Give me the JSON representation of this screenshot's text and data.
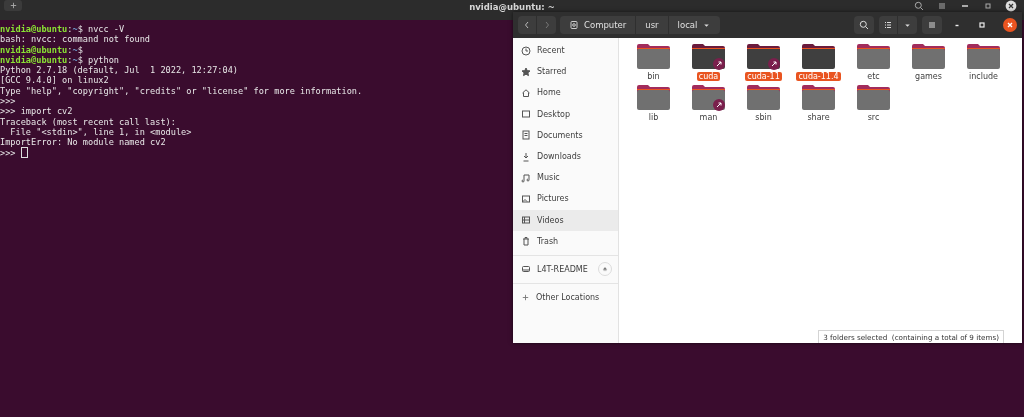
{
  "terminal": {
    "title": "nvidia@ubuntu: ~",
    "lines": [
      {
        "kind": "prompt",
        "user": "nvidia@ubuntu",
        "separator": ":",
        "path": "~",
        "symbol": "$",
        "command": "nvcc -V"
      },
      {
        "kind": "output",
        "text": "bash: nvcc: command not found"
      },
      {
        "kind": "prompt",
        "user": "nvidia@ubuntu",
        "separator": ":",
        "path": "~",
        "symbol": "$"
      },
      {
        "kind": "prompt",
        "user": "nvidia@ubuntu",
        "separator": ":",
        "path": "~",
        "symbol": "$",
        "command": "python"
      },
      {
        "kind": "output",
        "text": "Python 2.7.18 (default, Jul  1 2022, 12:27:04)"
      },
      {
        "kind": "output",
        "text": "[GCC 9.4.0] on linux2"
      },
      {
        "kind": "output",
        "text": "Type \"help\", \"copyright\", \"credits\" or \"license\" for more information."
      },
      {
        "kind": "output",
        "text": ">>>"
      },
      {
        "kind": "output",
        "text": ">>> import cv2"
      },
      {
        "kind": "output",
        "text": "Traceback (most recent call last):"
      },
      {
        "kind": "output",
        "text": "  File \"<stdin>\", line 1, in <module>"
      },
      {
        "kind": "output",
        "text": "ImportError: No module named cv2"
      },
      {
        "kind": "input",
        "text": ">>>"
      }
    ]
  },
  "files": {
    "path": [
      {
        "label": "Computer",
        "kind": "root"
      },
      {
        "label": "usr",
        "kind": "folder"
      },
      {
        "label": "local",
        "kind": "current"
      }
    ],
    "sidebar": [
      {
        "label": "Recent",
        "selected": false
      },
      {
        "label": "Starred",
        "selected": false
      },
      {
        "label": "Home",
        "selected": false
      },
      {
        "label": "Desktop",
        "selected": false
      },
      {
        "label": "Documents",
        "selected": false
      },
      {
        "label": "Downloads",
        "selected": false
      },
      {
        "label": "Music",
        "selected": false
      },
      {
        "label": "Pictures",
        "selected": false
      },
      {
        "label": "Videos",
        "selected": true
      },
      {
        "label": "Trash",
        "selected": false
      }
    ],
    "devices": [
      {
        "label": "L4T-README"
      }
    ],
    "other_locations": "Other Locations",
    "items": [
      {
        "name": "bin",
        "link": false,
        "selected": false
      },
      {
        "name": "cuda",
        "link": true,
        "selected": true
      },
      {
        "name": "cuda-11",
        "link": true,
        "selected": true
      },
      {
        "name": "cuda-11.4",
        "link": false,
        "selected": true
      },
      {
        "name": "etc",
        "link": false,
        "selected": false
      },
      {
        "name": "games",
        "link": false,
        "selected": false
      },
      {
        "name": "include",
        "link": false,
        "selected": false
      },
      {
        "name": "lib",
        "link": false,
        "selected": false
      },
      {
        "name": "man",
        "link": true,
        "selected": false
      },
      {
        "name": "sbin",
        "link": false,
        "selected": false
      },
      {
        "name": "share",
        "link": false,
        "selected": false
      },
      {
        "name": "src",
        "link": false,
        "selected": false
      }
    ],
    "status": "3 folders selected  (containing a total of 9 items)"
  }
}
